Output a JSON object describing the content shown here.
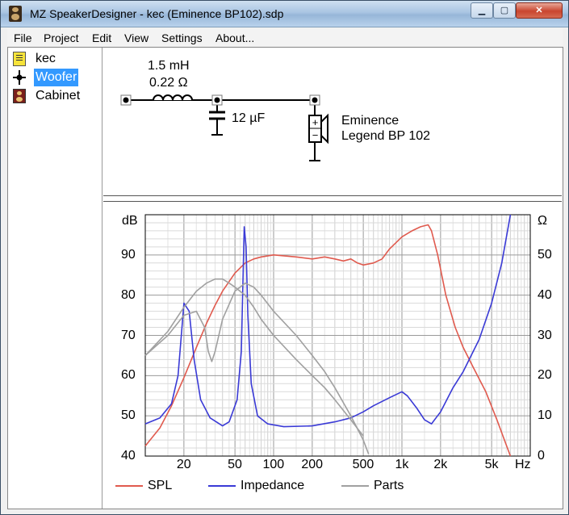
{
  "window": {
    "title": "MZ SpeakerDesigner - kec (Eminence BP102).sdp"
  },
  "menu": [
    "File",
    "Project",
    "Edit",
    "View",
    "Settings",
    "About..."
  ],
  "tree": [
    {
      "label": "kec",
      "icon": "notes-icon"
    },
    {
      "label": "Woofer",
      "icon": "woofer-node-icon",
      "selected": true
    },
    {
      "label": "Cabinet",
      "icon": "cabinet-icon"
    }
  ],
  "circuit": {
    "inductor": {
      "inductance": "1.5 mH",
      "resistance": "0.22 Ω"
    },
    "capacitor": {
      "value": "12 µF"
    },
    "driver": {
      "brand": "Eminence",
      "model": "Legend BP 102"
    }
  },
  "colors": {
    "spl": "#e05a4e",
    "impedance": "#3a3ad6",
    "parts": "#a0a0a0"
  },
  "chart_data": {
    "type": "line",
    "xscale": "log",
    "xlim": [
      10,
      10000
    ],
    "ylim_left": [
      40,
      100
    ],
    "ylim_right": [
      0,
      60
    ],
    "ylabel_left": "dB",
    "ylabel_right": "Ω",
    "xunit": "Hz",
    "x_ticks": [
      {
        "v": 20,
        "t": "20"
      },
      {
        "v": 50,
        "t": "50"
      },
      {
        "v": 100,
        "t": "100"
      },
      {
        "v": 200,
        "t": "200"
      },
      {
        "v": 500,
        "t": "500"
      },
      {
        "v": 1000,
        "t": "1k"
      },
      {
        "v": 2000,
        "t": "2k"
      },
      {
        "v": 5000,
        "t": "5k"
      }
    ],
    "y_ticks_left": [
      40,
      50,
      60,
      70,
      80,
      90
    ],
    "y_ticks_right": [
      0,
      10,
      20,
      30,
      40,
      50
    ],
    "legend": [
      "SPL",
      "Impedance",
      "Parts"
    ],
    "series": [
      {
        "name": "SPL",
        "axis": "left",
        "color": "#e05a4e",
        "points": [
          [
            10,
            42.5
          ],
          [
            13,
            47
          ],
          [
            16,
            52.5
          ],
          [
            20,
            59.5
          ],
          [
            25,
            67
          ],
          [
            30,
            73
          ],
          [
            35,
            77.5
          ],
          [
            40,
            81
          ],
          [
            50,
            85.5
          ],
          [
            60,
            88
          ],
          [
            70,
            89
          ],
          [
            80,
            89.5
          ],
          [
            100,
            90
          ],
          [
            150,
            89.5
          ],
          [
            200,
            89
          ],
          [
            250,
            89.5
          ],
          [
            300,
            89
          ],
          [
            350,
            88.5
          ],
          [
            400,
            89
          ],
          [
            450,
            88
          ],
          [
            500,
            87.5
          ],
          [
            600,
            88
          ],
          [
            700,
            89
          ],
          [
            800,
            91.5
          ],
          [
            1000,
            94.5
          ],
          [
            1200,
            96
          ],
          [
            1400,
            97
          ],
          [
            1600,
            97.5
          ],
          [
            1700,
            96
          ],
          [
            1900,
            90
          ],
          [
            2200,
            80
          ],
          [
            2600,
            72
          ],
          [
            3000,
            67
          ],
          [
            3600,
            62
          ],
          [
            4500,
            56
          ],
          [
            5500,
            49
          ],
          [
            7000,
            40
          ]
        ]
      },
      {
        "name": "Impedance",
        "axis": "right",
        "color": "#3a3ad6",
        "points": [
          [
            10,
            8
          ],
          [
            13,
            9.5
          ],
          [
            16,
            13
          ],
          [
            18,
            20
          ],
          [
            20,
            38
          ],
          [
            22,
            36
          ],
          [
            24,
            24
          ],
          [
            27,
            14
          ],
          [
            32,
            9.5
          ],
          [
            40,
            7.5
          ],
          [
            45,
            8.5
          ],
          [
            52,
            14
          ],
          [
            56,
            26
          ],
          [
            59,
            57
          ],
          [
            61,
            52
          ],
          [
            63,
            35
          ],
          [
            67,
            18
          ],
          [
            75,
            10
          ],
          [
            90,
            8
          ],
          [
            120,
            7.3
          ],
          [
            200,
            7.5
          ],
          [
            300,
            8.5
          ],
          [
            400,
            9.5
          ],
          [
            500,
            11
          ],
          [
            600,
            12.5
          ],
          [
            800,
            14.5
          ],
          [
            1000,
            16
          ],
          [
            1100,
            15
          ],
          [
            1300,
            12
          ],
          [
            1500,
            9
          ],
          [
            1700,
            8
          ],
          [
            2000,
            11
          ],
          [
            2500,
            17
          ],
          [
            3000,
            21
          ],
          [
            4000,
            29
          ],
          [
            5000,
            38
          ],
          [
            6000,
            48
          ],
          [
            7000,
            60
          ]
        ]
      },
      {
        "name": "Parts",
        "axis": "left",
        "color": "#a0a0a0",
        "points": [
          [
            10,
            65
          ],
          [
            15,
            70
          ],
          [
            20,
            75
          ],
          [
            25,
            76
          ],
          [
            29,
            72
          ],
          [
            31,
            66
          ],
          [
            33,
            63.5
          ],
          [
            35,
            66
          ],
          [
            40,
            74
          ],
          [
            50,
            81
          ],
          [
            60,
            83
          ],
          [
            70,
            82
          ],
          [
            80,
            80
          ],
          [
            100,
            76
          ],
          [
            150,
            70
          ],
          [
            200,
            65
          ],
          [
            250,
            61
          ],
          [
            300,
            57
          ],
          [
            400,
            50
          ],
          [
            500,
            44
          ],
          [
            550,
            40.5
          ]
        ]
      },
      {
        "name": "Parts",
        "axis": "left",
        "color": "#a0a0a0",
        "points": [
          [
            10,
            65
          ],
          [
            15,
            71
          ],
          [
            20,
            77
          ],
          [
            25,
            81
          ],
          [
            30,
            83
          ],
          [
            35,
            84
          ],
          [
            40,
            84
          ],
          [
            45,
            83
          ],
          [
            50,
            82
          ],
          [
            60,
            80
          ],
          [
            70,
            77
          ],
          [
            80,
            74
          ],
          [
            100,
            70
          ],
          [
            150,
            64
          ],
          [
            200,
            60
          ],
          [
            250,
            57
          ],
          [
            300,
            54
          ],
          [
            400,
            49
          ],
          [
            500,
            45
          ]
        ]
      }
    ]
  }
}
